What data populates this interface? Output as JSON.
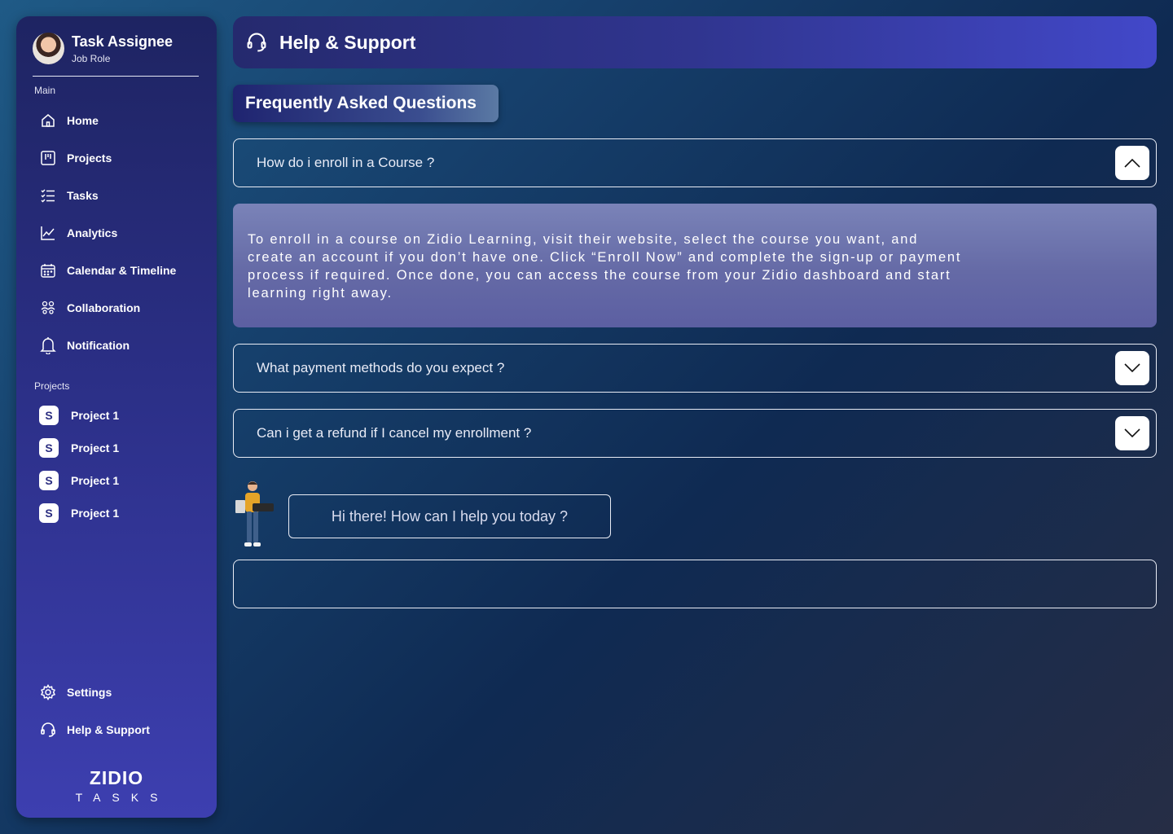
{
  "profile": {
    "name": "Task Assignee",
    "role": "Job Role"
  },
  "sidebar": {
    "main_label": "Main",
    "main_items": [
      {
        "label": "Home",
        "icon": "home-icon"
      },
      {
        "label": "Projects",
        "icon": "kanban-icon"
      },
      {
        "label": "Tasks",
        "icon": "checklist-icon"
      },
      {
        "label": "Analytics",
        "icon": "chart-line-icon"
      },
      {
        "label": "Calendar & Timeline",
        "icon": "calendar-icon"
      },
      {
        "label": "Collaboration",
        "icon": "people-icon"
      },
      {
        "label": "Notification",
        "icon": "bell-icon"
      }
    ],
    "projects_label": "Projects",
    "projects": [
      {
        "label": "Project 1",
        "badge": "S"
      },
      {
        "label": "Project 1",
        "badge": "S"
      },
      {
        "label": "Project 1",
        "badge": "S"
      },
      {
        "label": "Project 1",
        "badge": "S"
      }
    ],
    "bottom_items": [
      {
        "label": "Settings",
        "icon": "gear-icon"
      },
      {
        "label": "Help & Support",
        "icon": "headset-icon"
      }
    ],
    "logo": {
      "word": "ZIDIO",
      "sub": "TASKS"
    }
  },
  "header": {
    "title": "Help & Support",
    "icon": "headset-icon"
  },
  "faq": {
    "title": "Frequently Asked Questions",
    "items": [
      {
        "question": "How do i enroll in a Course ?",
        "expanded": true,
        "answer": "To enroll in a course on Zidio Learning, visit their website, select the course you want, and create an account if you don’t have one. Click “Enroll Now” and complete the sign-up or payment process if required. Once done, you can access the course from your Zidio dashboard and start learning right away."
      },
      {
        "question": "What payment methods do you expect ?",
        "expanded": false
      },
      {
        "question": "Can i get a refund if I cancel my enrollment ?",
        "expanded": false
      }
    ]
  },
  "chat": {
    "greeting": "Hi there! How can I help you today ?",
    "input_value": ""
  },
  "colors": {
    "accent": "#3d3fb0",
    "sidebar_top": "#1e2462",
    "answer_bg": "#656aa6"
  }
}
